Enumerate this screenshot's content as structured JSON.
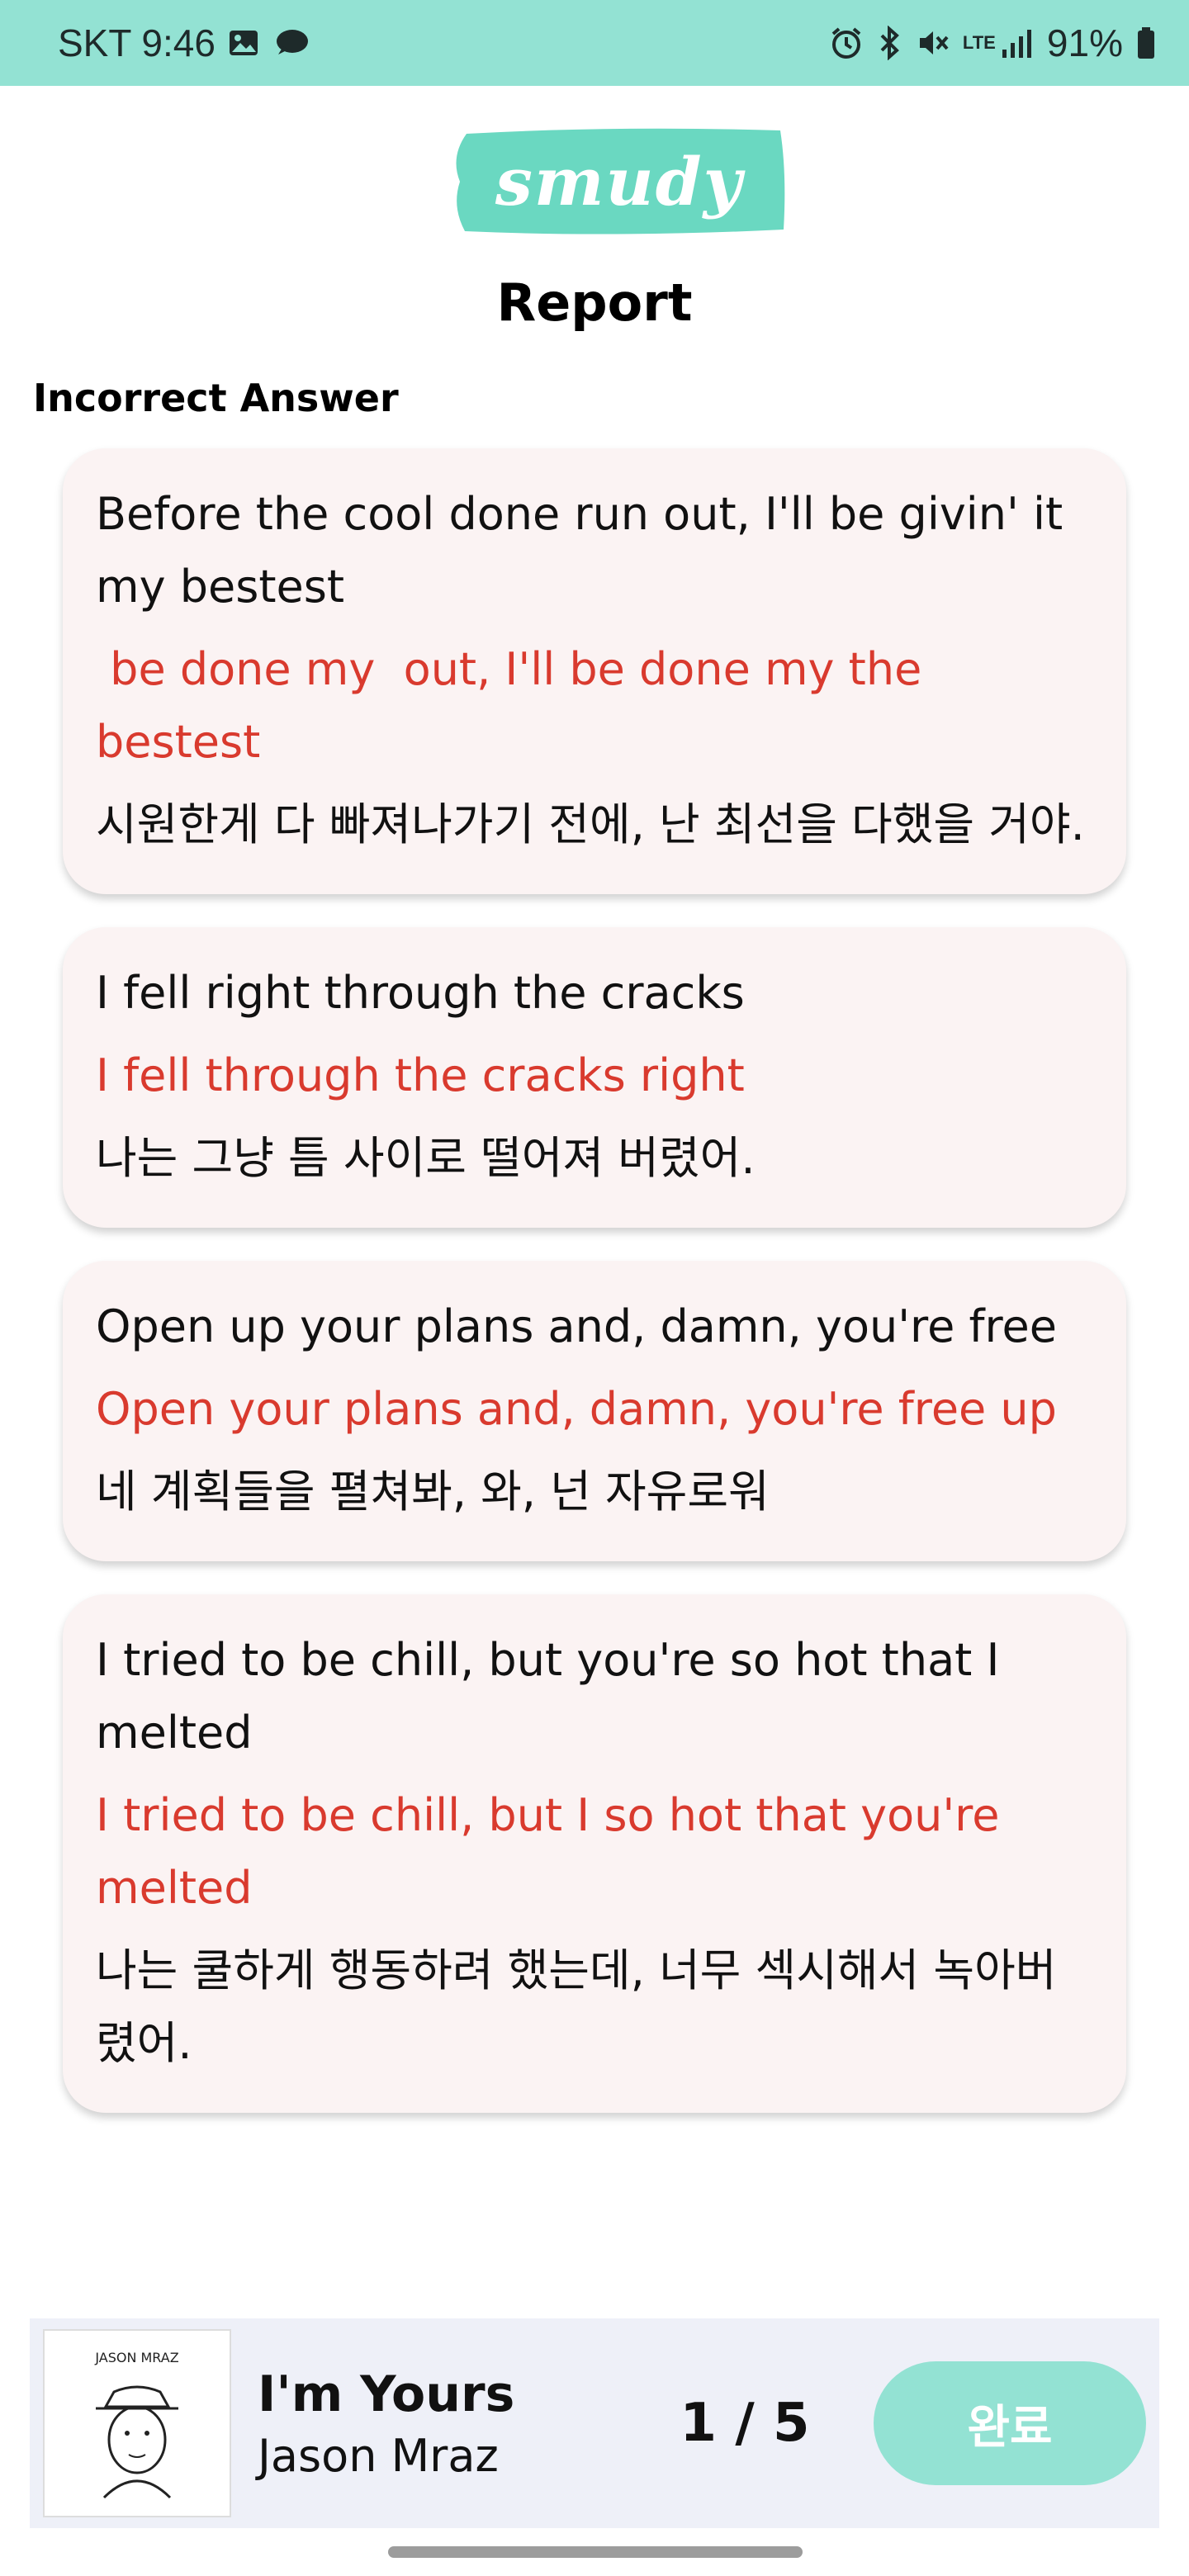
{
  "status_bar": {
    "carrier_time": "SKT 9:46",
    "network": "LTE",
    "battery": "91%"
  },
  "logo": {
    "text": "smudy"
  },
  "page_title": "Report",
  "section_title": "Incorrect Answer",
  "cards": [
    {
      "original": "Before the cool done run out, I'll be givin' it my bestest",
      "answer": " be done my  out, I'll be done my the bestest",
      "translation": "시원한게 다 빠져나가기 전에, 난 최선을 다했을 거야."
    },
    {
      "original": "I fell right through the cracks",
      "answer": "I fell through the cracks right",
      "translation": "나는 그냥 틈 사이로 떨어져 버렸어."
    },
    {
      "original": "Open up your plans and, damn, you're free",
      "answer": "Open your plans and, damn, you're free up",
      "translation": "네 계획들을 펼쳐봐, 와, 넌 자유로워"
    },
    {
      "original": "I tried to be chill, but you're so hot that I melted",
      "answer": "I tried to be chill, but I so hot that you're melted",
      "translation": "나는 쿨하게 행동하려 했는데, 너무 섹시해서 녹아버렸어."
    }
  ],
  "footer": {
    "song_title": "I'm Yours",
    "artist": "Jason Mraz",
    "album_label": "JASON MRAZ",
    "progress": "1 / 5",
    "done_label": "완료"
  },
  "colors": {
    "accent": "#93e2d3",
    "error_text": "#d93a2e",
    "card_bg": "#fbf3f3"
  }
}
